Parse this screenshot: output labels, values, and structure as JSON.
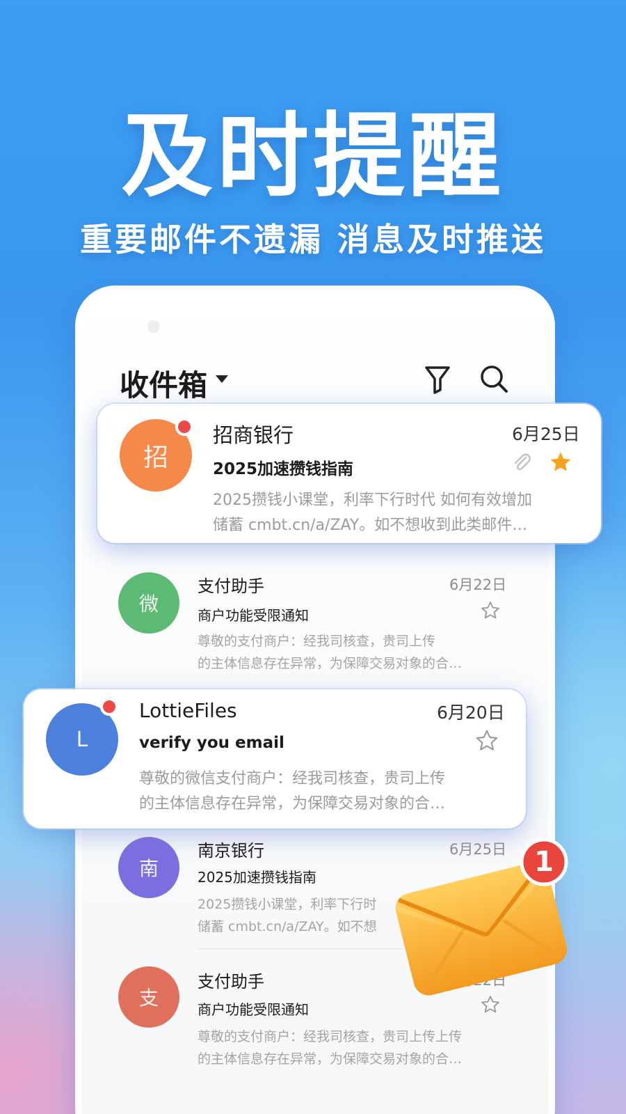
{
  "hero": {
    "headline": "及时提醒",
    "subline": "重要邮件不遗漏  消息及时推送"
  },
  "app_bar": {
    "title": "收件箱",
    "filter_icon": "filter-icon",
    "search_icon": "search-icon"
  },
  "emails": [
    {
      "avatar_char": "招",
      "avatar_color": "#f6894a",
      "unread": true,
      "sender": "招商银行",
      "date": "6月25日",
      "subject": "2025加速攒钱指南",
      "preview_1": "2025攒钱小课堂，利率下行时代 如何有效增加",
      "preview_2": "储蓄 cmbt.cn/a/ZAY。如不想收到此类邮件…",
      "attachment": true,
      "starred": true
    },
    {
      "avatar_char": "微",
      "avatar_color": "#5dba74",
      "unread": false,
      "sender": "支付助手",
      "date": "6月22日",
      "subject": "商户功能受限通知",
      "preview_1": "尊敬的支付商户：经我司核查，贵司上传",
      "preview_2": "的主体信息存在异常，为保障交易对象的合…",
      "attachment": false,
      "starred": false
    },
    {
      "avatar_char": "L",
      "avatar_color": "#4d7fdc",
      "unread": true,
      "sender": "LottieFiles",
      "date": "6月20日",
      "subject": "verify you email",
      "preview_1": "尊敬的微信支付商户：经我司核查，贵司上传",
      "preview_2": "的主体信息存在异常，为保障交易对象的合…",
      "attachment": false,
      "starred": false
    },
    {
      "avatar_char": "南",
      "avatar_color": "#7b6fe0",
      "unread": false,
      "sender": "南京银行",
      "date": "6月25日",
      "subject": "2025加速攒钱指南",
      "preview_1": "2025攒钱小课堂，利率下行时",
      "preview_2": "储蓄 cmbt.cn/a/ZAY。如不想",
      "attachment": false,
      "starred": false
    },
    {
      "avatar_char": "支",
      "avatar_color": "#e0705c",
      "unread": false,
      "sender": "支付助手",
      "date": "6月22日",
      "subject": "商户功能受限通知",
      "preview_1": "尊敬的支付商户：经我司核查，贵司上传上传",
      "preview_2": "的主体信息存在异常，为保障交易对象的合…",
      "attachment": false,
      "starred": false
    }
  ],
  "notification": {
    "badge_count": "1",
    "envelope_color": "#f7b531",
    "badge_color": "#e8463c"
  }
}
